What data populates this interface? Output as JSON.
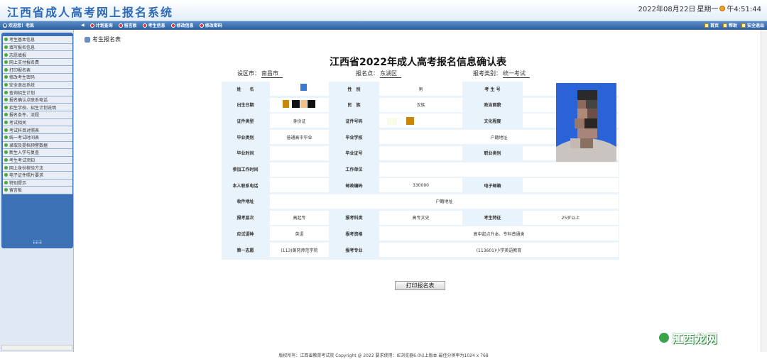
{
  "header": {
    "site_title": "江西省成人高考网上报名系统",
    "date_text": "2022年08月22日",
    "weekday_text": "星期一",
    "time_text": "午4:51:44"
  },
  "nav": {
    "welcome": "欢迎您！老凯",
    "items": [
      "计划查询",
      "留言板",
      "考生信息",
      "修改信息",
      "修改密码"
    ],
    "right_items": [
      "首页",
      "帮助",
      "安全退出"
    ]
  },
  "sidebar": {
    "items": [
      "考生基本信息",
      "填写报名信息",
      "志愿填报",
      "网上支付报名费",
      "打印报名表",
      "修改考生密码",
      "安全退出系统",
      "查询招生计划",
      "报名确认点联系电话",
      "招生学校、招生计划说明",
      "报名条件、流程",
      "考试相关",
      "考试科目对照表",
      "统一考试时间表",
      "录取及提档预警数据",
      "新生入学与复查",
      "考生考试须知",
      "网上身份核验方法",
      "电子证件照片要求",
      "特别提示",
      "留言板"
    ],
    "grip": "⠿⠿⠿"
  },
  "main": {
    "page_title": "考生报名表",
    "form_title": "江西省2022年成人高考报名信息确认表",
    "district_label": "设区市：",
    "district_value": "南昌市",
    "site_label": "报名点：",
    "site_value": "东湖区",
    "category_label": "报考类别：",
    "category_value": "统一考试",
    "print_button": "打印报名表"
  },
  "form": {
    "rows": [
      [
        {
          "t": "姓　　名",
          "k": "l"
        },
        {
          "t": "",
          "k": "v"
        },
        {
          "t": "性　别",
          "k": "l"
        },
        {
          "t": "男",
          "k": "v"
        },
        {
          "t": "考 生 号",
          "k": "l"
        },
        {
          "t": "",
          "k": "v"
        }
      ],
      [
        {
          "t": "出生日期",
          "k": "l"
        },
        {
          "t": "",
          "k": "v"
        },
        {
          "t": "民　族",
          "k": "l"
        },
        {
          "t": "汉族",
          "k": "v"
        },
        {
          "t": "政治面貌",
          "k": "l"
        },
        {
          "t": "群众",
          "k": "v"
        }
      ],
      [
        {
          "t": "证件类型",
          "k": "l"
        },
        {
          "t": "身份证",
          "k": "v"
        },
        {
          "t": "证件号码",
          "k": "l"
        },
        {
          "t": "",
          "k": "v"
        },
        {
          "t": "文化程度",
          "k": "l"
        },
        {
          "t": "普通高中毕业",
          "k": "v"
        }
      ],
      [
        {
          "t": "毕业类别",
          "k": "l"
        },
        {
          "t": "普通高中毕业",
          "k": "v"
        },
        {
          "t": "毕业学校",
          "k": "l"
        },
        {
          "t": "户籍地址",
          "k": "v"
        }
      ],
      [
        {
          "t": "毕业时间",
          "k": "l"
        },
        {
          "t": "",
          "k": "v"
        },
        {
          "t": "毕业证号",
          "k": "l"
        },
        {
          "t": "",
          "k": "v"
        },
        {
          "t": "职业类别",
          "k": "l"
        },
        {
          "t": "",
          "k": "v"
        }
      ],
      [
        {
          "t": "参加工作时间",
          "k": "l"
        },
        {
          "t": "",
          "k": "v"
        },
        {
          "t": "工作单位",
          "k": "l"
        },
        {
          "t": "",
          "k": "v"
        }
      ],
      [
        {
          "t": "本人联系电话",
          "k": "l"
        },
        {
          "t": "",
          "k": "v"
        },
        {
          "t": "邮政编码",
          "k": "l"
        },
        {
          "t": "330000",
          "k": "v"
        },
        {
          "t": "电子邮箱",
          "k": "l"
        },
        {
          "t": "",
          "k": "v"
        }
      ],
      [
        {
          "t": "收件地址",
          "k": "l"
        },
        {
          "t": "户籍地址",
          "k": "v"
        }
      ],
      [
        {
          "t": "报考层次",
          "k": "l"
        },
        {
          "t": "高起专",
          "k": "v"
        },
        {
          "t": "报考科类",
          "k": "l"
        },
        {
          "t": "高专文史",
          "k": "v"
        },
        {
          "t": "考生特征",
          "k": "l"
        },
        {
          "t": "25岁以上",
          "k": "v"
        }
      ],
      [
        {
          "t": "应试语种",
          "k": "l"
        },
        {
          "t": "英语",
          "k": "v"
        },
        {
          "t": "报考资格",
          "k": "l"
        },
        {
          "t": "高中起点升本、专科普通类",
          "k": "v"
        }
      ],
      [
        {
          "t": "第一志愿",
          "k": "l"
        },
        {
          "t": "(113)黄冈师范学院",
          "k": "v"
        },
        {
          "t": "报考专业",
          "k": "l"
        },
        {
          "t": "(113601)小学英语教育",
          "k": "v"
        }
      ]
    ]
  },
  "footer": {
    "text": "版权所有：江西省教育考试院 Copyright @ 2022 要求使用：IE浏览器6.0以上版本 最佳分辨率为1024 x 768"
  },
  "watermark": {
    "text": "江西龙网"
  },
  "colors": {
    "accent": "#2e69b8",
    "nav": "#3c72b5",
    "label_bg": "#e9f3fb"
  }
}
